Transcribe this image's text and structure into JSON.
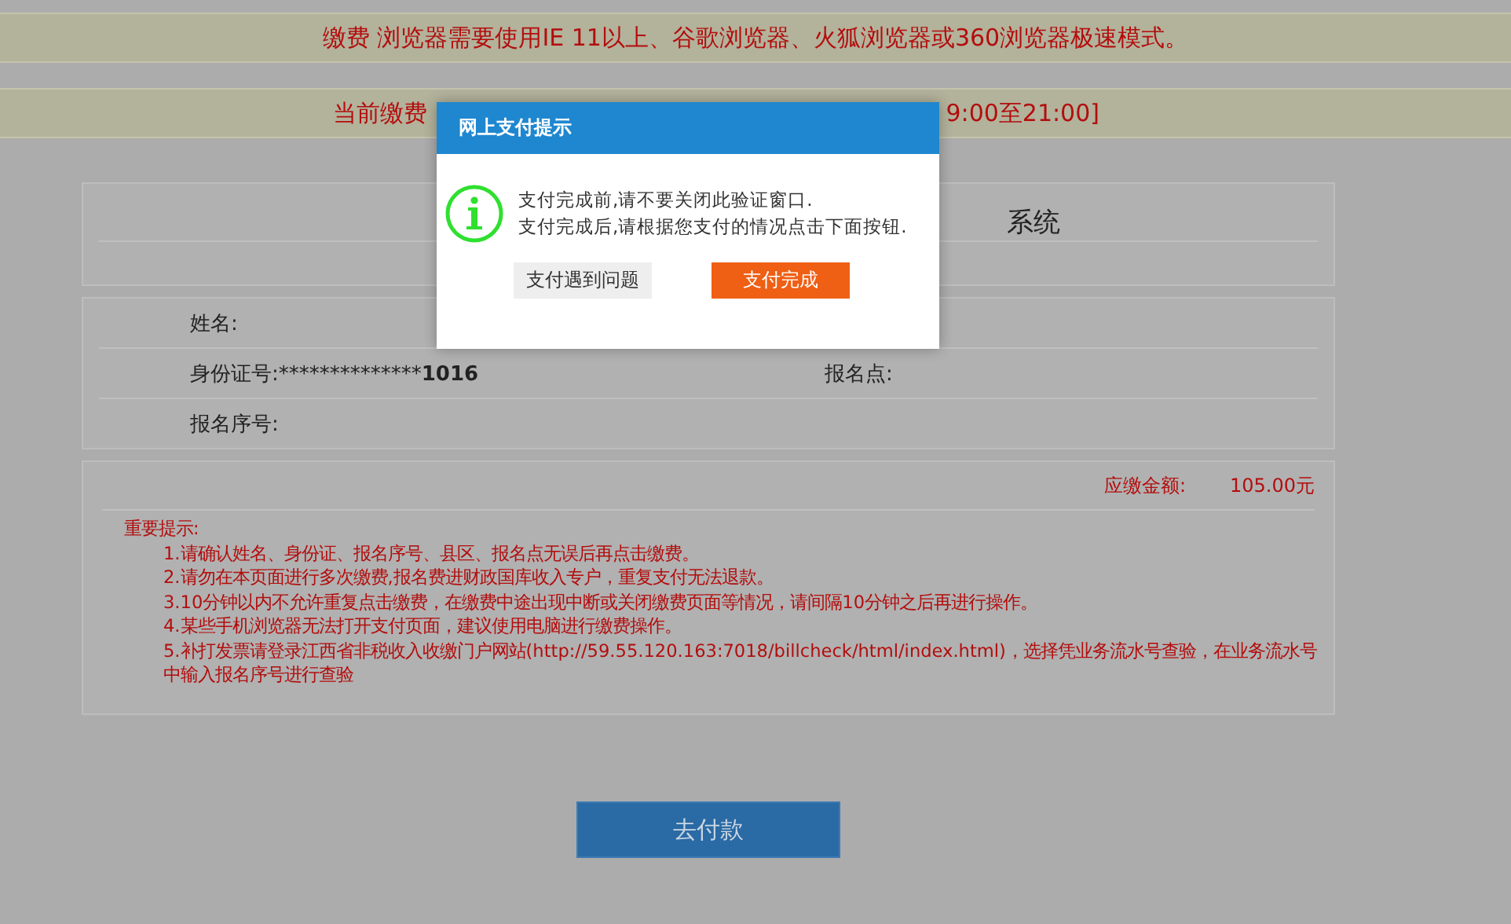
{
  "browser_notice": "缴费 浏览器需要使用IE 11以上、谷歌浏览器、火狐浏览器或360浏览器极速模式。",
  "time_notice": {
    "left": "当前缴费",
    "right": "9:00至21:00]"
  },
  "title_panel": {
    "title": "系统"
  },
  "info": {
    "rows": [
      {
        "left": "姓名:",
        "right": ""
      },
      {
        "left": "身份证号:**************",
        "left_bold": "1016",
        "right": "报名点:"
      },
      {
        "left": "报名序号:",
        "right": ""
      }
    ]
  },
  "amount": {
    "label": "应缴金额:",
    "value": "105.00元"
  },
  "tips": {
    "heading": "重要提示:",
    "items": [
      "1.请确认姓名、身份证、报名序号、县区、报名点无误后再点击缴费。",
      "2.请勿在本页面进行多次缴费,报名费进财政国库收入专户，重复支付无法退款。",
      "3.10分钟以内不允许重复点击缴费，在缴费中途出现中断或关闭缴费页面等情况，请间隔10分钟之后再进行操作。",
      "4.某些手机浏览器无法打开支付页面，建议使用电脑进行缴费操作。",
      "5.补打发票请登录江西省非税收入收缴门户网站(http://59.55.120.163:7018/billcheck/html/index.html)，选择凭业务流水号查验，在业务流水号中输入报名序号进行查验"
    ]
  },
  "pay_button": "去付款",
  "dialog": {
    "title": "网上支付提示",
    "lines": [
      "支付完成前,请不要关闭此验证窗口.",
      "支付完成后,请根据您支付的情况点击下面按钮."
    ],
    "buttons": [
      {
        "label": "支付遇到问题",
        "kind": "secondary"
      },
      {
        "label": "支付完成",
        "kind": "primary"
      }
    ]
  }
}
